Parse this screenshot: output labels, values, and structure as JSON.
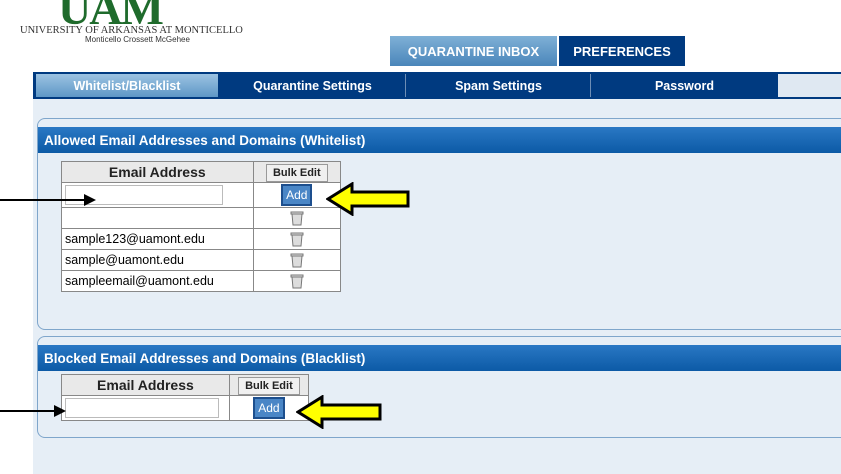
{
  "brand": {
    "logo_text": "UAM",
    "university_name": "UNIVERSITY OF ARKANSAS AT MONTICELLO",
    "campuses": "Monticello   Crossett   McGehee",
    "logo_color": "#1f6b2c"
  },
  "top_tabs": [
    {
      "label": "QUARANTINE INBOX",
      "active": false
    },
    {
      "label": "PREFERENCES",
      "active": true
    }
  ],
  "sub_nav": [
    {
      "label": "Whitelist/Blacklist",
      "active": true
    },
    {
      "label": "Quarantine Settings",
      "active": false
    },
    {
      "label": "Spam Settings",
      "active": false
    },
    {
      "label": "Password",
      "active": false
    }
  ],
  "whitelist": {
    "title": "Allowed Email Addresses and Domains (Whitelist)",
    "column_header": "Email Address",
    "bulk_edit_label": "Bulk Edit",
    "add_label": "Add",
    "input_value": "",
    "entries": [
      "",
      "sample123@uamont.edu",
      "sample@uamont.edu",
      "sampleemail@uamont.edu"
    ]
  },
  "blacklist": {
    "title": "Blocked Email Addresses and Domains (Blacklist)",
    "column_header": "Email Address",
    "bulk_edit_label": "Bulk Edit",
    "add_label": "Add",
    "input_value": ""
  },
  "colors": {
    "nav_dark": "#003a80",
    "panel_header": "#0c5aa6",
    "highlight_arrow": "#ffff00"
  }
}
